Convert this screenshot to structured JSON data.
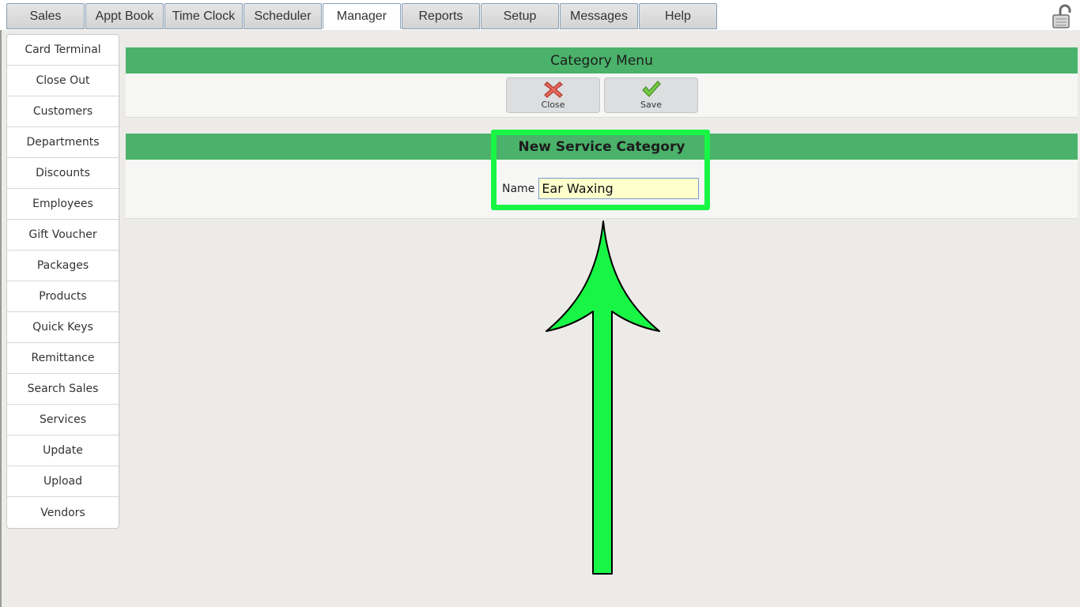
{
  "tabs": [
    {
      "label": "Sales"
    },
    {
      "label": "Appt Book"
    },
    {
      "label": "Time Clock"
    },
    {
      "label": "Scheduler"
    },
    {
      "label": "Manager"
    },
    {
      "label": "Reports"
    },
    {
      "label": "Setup"
    },
    {
      "label": "Messages"
    },
    {
      "label": "Help"
    }
  ],
  "active_tab": "Manager",
  "sidebar": {
    "items": [
      {
        "label": "Card Terminal"
      },
      {
        "label": "Close Out"
      },
      {
        "label": "Customers"
      },
      {
        "label": "Departments"
      },
      {
        "label": "Discounts"
      },
      {
        "label": "Employees"
      },
      {
        "label": "Gift Voucher"
      },
      {
        "label": "Packages"
      },
      {
        "label": "Products"
      },
      {
        "label": "Quick Keys"
      },
      {
        "label": "Remittance"
      },
      {
        "label": "Search Sales"
      },
      {
        "label": "Services"
      },
      {
        "label": "Update"
      },
      {
        "label": "Upload"
      },
      {
        "label": "Vendors"
      }
    ]
  },
  "category_menu": {
    "title": "Category Menu",
    "close_label": "Close",
    "save_label": "Save"
  },
  "new_category": {
    "title": "New Service Category",
    "name_label": "Name",
    "name_value": "Ear Waxing"
  },
  "colors": {
    "header_green": "#4ab26a",
    "annotation_green": "#18f545",
    "input_bg": "#ffffcc"
  },
  "icons": {
    "lock": "padlock-unlocked-icon",
    "close": "red-x-icon",
    "save": "green-check-icon"
  }
}
